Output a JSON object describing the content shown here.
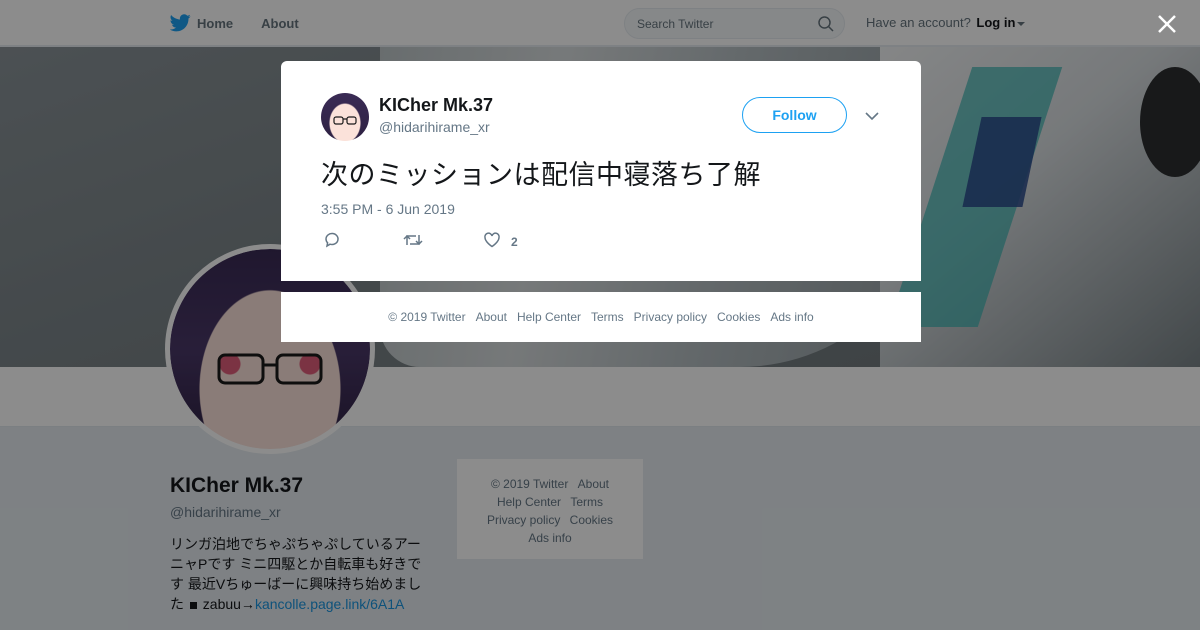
{
  "nav": {
    "home_label": "Home",
    "about_label": "About",
    "search_placeholder": "Search Twitter",
    "have_account": "Have an account?",
    "login_label": "Log in"
  },
  "profile": {
    "name": "KICher Mk.37",
    "handle": "@hidarihirame_xr",
    "bio": "リンガ泊地でちゃぷちゃぷしているアーニャPです ミニ四駆とか自転車も好きです 最近Vちゅーばーに興味持ち始めました ",
    "bio_suffix": " zabuu→",
    "bio_link": "kancolle.page.link/6A1A"
  },
  "side_footer": {
    "items": [
      "© 2019 Twitter",
      "About",
      "Help Center",
      "Terms",
      "Privacy policy",
      "Cookies",
      "Ads info"
    ]
  },
  "tweet": {
    "name": "KICher Mk.37",
    "handle": "@hidarihirame_xr",
    "follow_label": "Follow",
    "text": "次のミッションは配信中寝落ち了解",
    "timestamp": "3:55 PM - 6 Jun 2019",
    "like_count": "2"
  },
  "modal_footer": {
    "items": [
      "© 2019 Twitter",
      "About",
      "Help Center",
      "Terms",
      "Privacy policy",
      "Cookies",
      "Ads info"
    ]
  },
  "colors": {
    "accent": "#1da1f2",
    "link": "#1b95e0",
    "muted": "#657786"
  }
}
